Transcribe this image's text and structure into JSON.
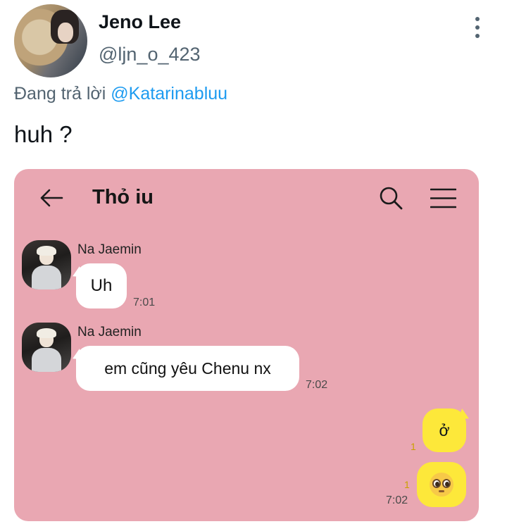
{
  "tweet": {
    "display_name": "Jeno Lee",
    "handle": "@ljn_o_423",
    "reply_prefix": "Đang trả lời",
    "reply_mention": "@Katarinabluu",
    "text": "huh ?",
    "more_icon": "more-vertical-icon"
  },
  "chat": {
    "background_color": "#e9a7b2",
    "title": "Thỏ iu",
    "icons": [
      "back-arrow-icon",
      "search-icon",
      "menu-icon"
    ],
    "messages": [
      {
        "sender": "Na Jaemin",
        "text": "Uh",
        "time": "7:01"
      },
      {
        "sender": "Na Jaemin",
        "text": "em cũng yêu Chenu nx",
        "time": "7:02"
      }
    ],
    "own_messages": [
      {
        "text": "ở",
        "unread": "1",
        "time": ""
      },
      {
        "text": "🥺",
        "unread": "1",
        "time": "7:02",
        "emoji_icon": "pleading-face-emoji"
      }
    ],
    "own_bubble_color": "#fde83a"
  }
}
